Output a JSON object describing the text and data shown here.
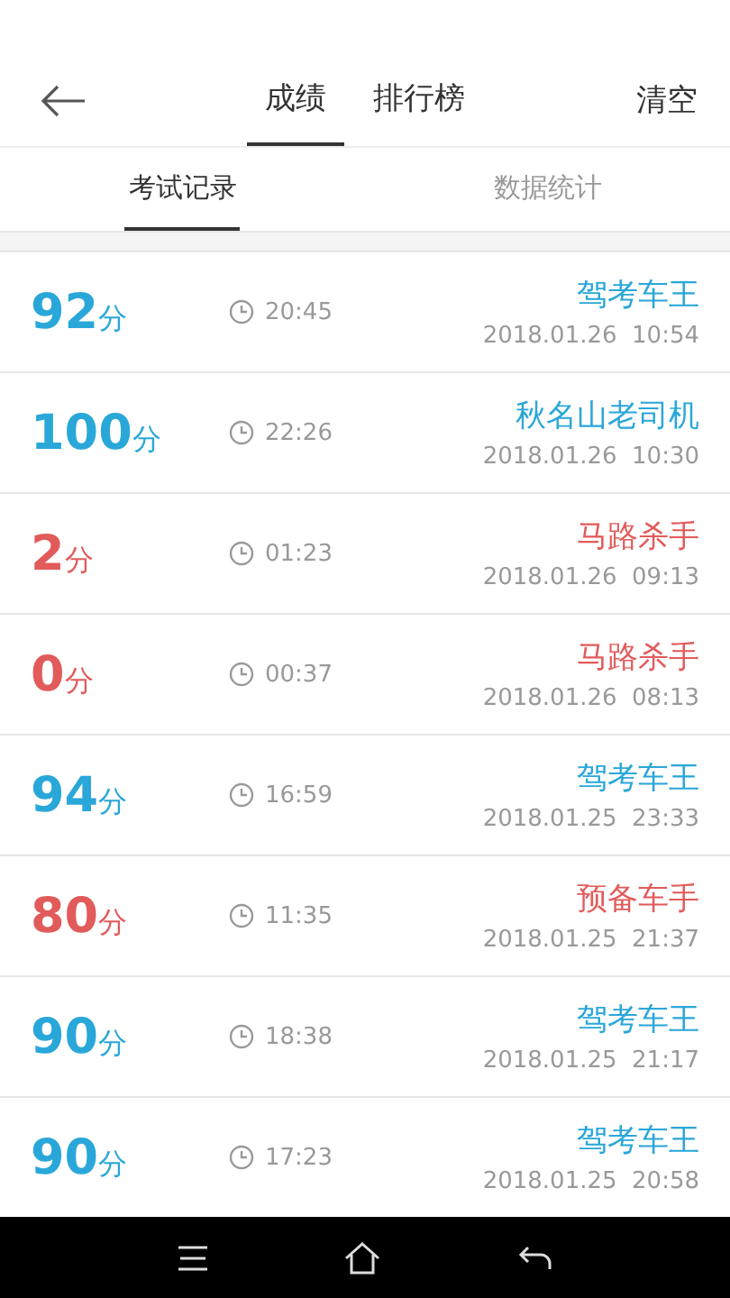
{
  "header": {
    "tabs": [
      {
        "label": "成绩",
        "selected": true
      },
      {
        "label": "排行榜",
        "selected": false
      }
    ],
    "action": "清空"
  },
  "subtabs": [
    {
      "label": "考试记录",
      "selected": true
    },
    {
      "label": "数据统计",
      "selected": false
    }
  ],
  "records": [
    {
      "score": "92",
      "unit": "分",
      "duration": "20:45",
      "title": "驾考车王",
      "datetime": "2018.01.26  10:54",
      "passed": true
    },
    {
      "score": "100",
      "unit": "分",
      "duration": "22:26",
      "title": "秋名山老司机",
      "datetime": "2018.01.26  10:30",
      "passed": true
    },
    {
      "score": "2",
      "unit": "分",
      "duration": "01:23",
      "title": "马路杀手",
      "datetime": "2018.01.26  09:13",
      "passed": false
    },
    {
      "score": "0",
      "unit": "分",
      "duration": "00:37",
      "title": "马路杀手",
      "datetime": "2018.01.26  08:13",
      "passed": false
    },
    {
      "score": "94",
      "unit": "分",
      "duration": "16:59",
      "title": "驾考车王",
      "datetime": "2018.01.25  23:33",
      "passed": true
    },
    {
      "score": "80",
      "unit": "分",
      "duration": "11:35",
      "title": "预备车手",
      "datetime": "2018.01.25  21:37",
      "passed": false
    },
    {
      "score": "90",
      "unit": "分",
      "duration": "18:38",
      "title": "驾考车王",
      "datetime": "2018.01.25  21:17",
      "passed": true
    },
    {
      "score": "90",
      "unit": "分",
      "duration": "17:23",
      "title": "驾考车王",
      "datetime": "2018.01.25  20:58",
      "passed": true
    }
  ]
}
